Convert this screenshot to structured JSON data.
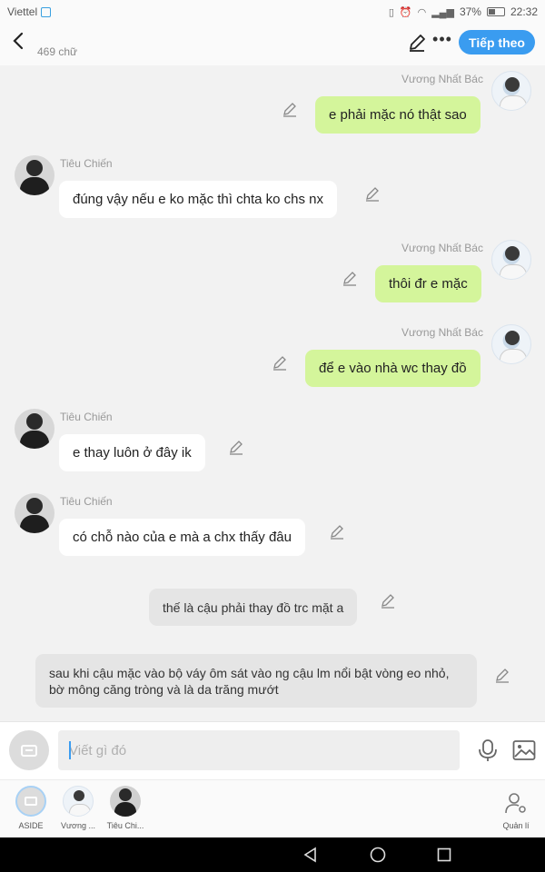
{
  "status_bar": {
    "carrier": "Viettel",
    "battery": "37%",
    "time": "22:32",
    "icons": [
      "vibrate-icon",
      "alarm-icon",
      "wifi-icon",
      "signal-icon",
      "battery-icon"
    ]
  },
  "header": {
    "word_count": "469 chữ",
    "next_label": "Tiếp theo",
    "accent_color": "#3a9cf0"
  },
  "messages": [
    {
      "side": "right",
      "name": "Vương Nhất Bác",
      "text": "e phải mặc nó thật sao",
      "style": "green"
    },
    {
      "side": "left",
      "name": "Tiêu Chiến",
      "text": "đúng vậy nếu e ko mặc thì chta ko chs nx",
      "style": "white"
    },
    {
      "side": "right",
      "name": "Vương Nhất Bác",
      "text": "thôi đr e mặc",
      "style": "green"
    },
    {
      "side": "right",
      "name": "Vương Nhất Bác",
      "text": "để e vào nhà wc thay đồ",
      "style": "green"
    },
    {
      "side": "left",
      "name": "Tiêu Chiến",
      "text": "e thay luôn ở đây ik",
      "style": "white"
    },
    {
      "side": "left",
      "name": "Tiêu Chiến",
      "text": "có chỗ nào của e mà a chx thấy đâu",
      "style": "white"
    },
    {
      "side": "center",
      "name": "",
      "text": "thế là cậu phải thay đồ trc mặt a",
      "style": "gray"
    },
    {
      "side": "center",
      "name": "",
      "text_lines": [
        "sau khi cậu mặc vào bộ váy ôm sát vào ng cậu lm nổi bật vòng eo nhỏ,",
        "bờ mông căng tròng và là da trăng mướt"
      ],
      "style": "gray"
    }
  ],
  "input": {
    "placeholder": "Viết gì đó"
  },
  "roles": [
    {
      "label": "ASIDE"
    },
    {
      "label": "Vương ..."
    },
    {
      "label": "Tiêu Chi..."
    }
  ],
  "manage_label": "Quản lí",
  "colors": {
    "bubble_green": "#d4f59b",
    "bubble_white": "#ffffff",
    "bubble_gray": "#e5e5e5",
    "background": "#f2f2f2"
  }
}
